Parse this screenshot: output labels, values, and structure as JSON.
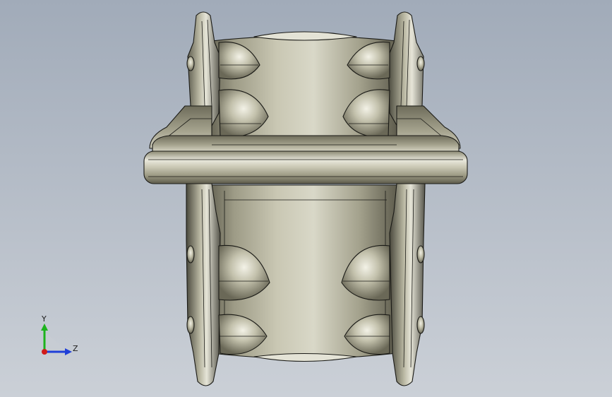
{
  "viewport": {
    "bg_top": "#a1abb9",
    "bg_bottom": "#cbd0d7"
  },
  "model": {
    "part": "flanged-spool",
    "body_color": "#b5b39c",
    "edge_color": "#1a1a16",
    "highlight_color": "#f4f3ea",
    "shadow_color": "#5a594c"
  },
  "triad": {
    "y_label": "Y",
    "z_label": "Z",
    "y_color": "#1db31d",
    "z_color": "#1f3fd8",
    "x_color": "#d11a1a"
  }
}
